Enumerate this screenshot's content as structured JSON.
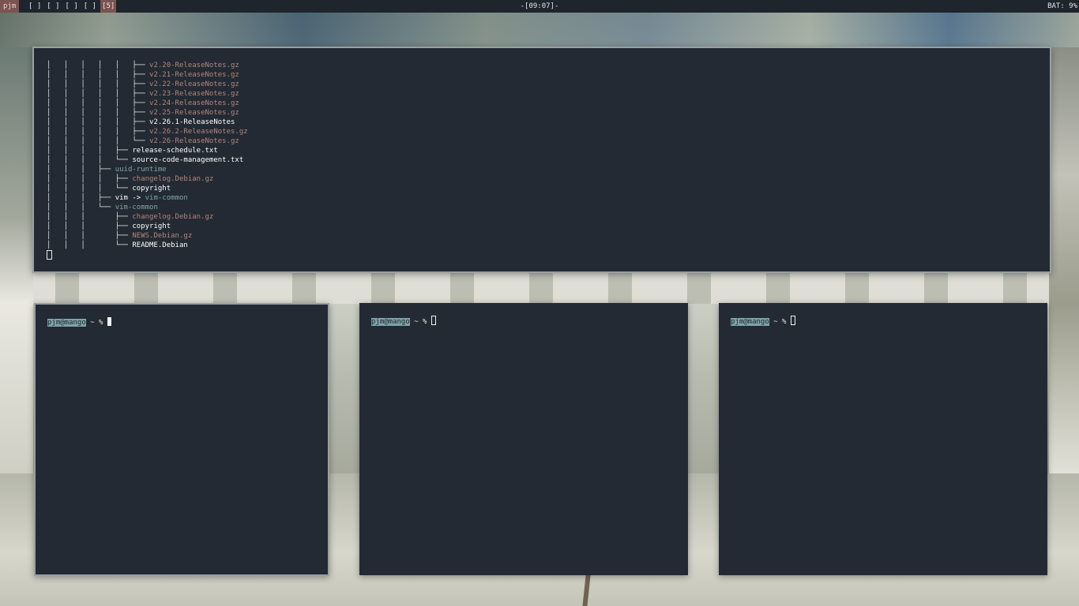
{
  "status_bar": {
    "user": "pjm",
    "workspaces": [
      {
        "label": "[ ]",
        "active": false
      },
      {
        "label": "[ ]",
        "active": false
      },
      {
        "label": "[ ]",
        "active": false
      },
      {
        "label": "[ ]",
        "active": false
      },
      {
        "label": "[5]",
        "active": true
      }
    ],
    "clock": "-[09:07]-",
    "battery": "BAT: 9%"
  },
  "tree_terminal": {
    "lines": [
      {
        "prefix": "│   │   │   │   │   ├── ",
        "name": "v2.20-ReleaseNotes.gz",
        "type": "gz"
      },
      {
        "prefix": "│   │   │   │   │   ├── ",
        "name": "v2.21-ReleaseNotes.gz",
        "type": "gz"
      },
      {
        "prefix": "│   │   │   │   │   ├── ",
        "name": "v2.22-ReleaseNotes.gz",
        "type": "gz"
      },
      {
        "prefix": "│   │   │   │   │   ├── ",
        "name": "v2.23-ReleaseNotes.gz",
        "type": "gz"
      },
      {
        "prefix": "│   │   │   │   │   ├── ",
        "name": "v2.24-ReleaseNotes.gz",
        "type": "gz"
      },
      {
        "prefix": "│   │   │   │   │   ├── ",
        "name": "v2.25-ReleaseNotes.gz",
        "type": "gz"
      },
      {
        "prefix": "│   │   │   │   │   ├── ",
        "name": "v2.26.1-ReleaseNotes",
        "type": "txt"
      },
      {
        "prefix": "│   │   │   │   │   ├── ",
        "name": "v2.26.2-ReleaseNotes.gz",
        "type": "gz"
      },
      {
        "prefix": "│   │   │   │   │   └── ",
        "name": "v2.26-ReleaseNotes.gz",
        "type": "gz"
      },
      {
        "prefix": "│   │   │   │   ├── ",
        "name": "release-schedule.txt",
        "type": "txt"
      },
      {
        "prefix": "│   │   │   │   └── ",
        "name": "source-code-management.txt",
        "type": "txt"
      },
      {
        "prefix": "│   │   │   ├── ",
        "name": "uuid-runtime",
        "type": "dir"
      },
      {
        "prefix": "│   │   │   │   ├── ",
        "name": "changelog.Debian.gz",
        "type": "gz"
      },
      {
        "prefix": "│   │   │   │   └── ",
        "name": "copyright",
        "type": "txt"
      },
      {
        "prefix": "│   │   │   ├── ",
        "name": "vim -> ",
        "type": "txt",
        "target": "vim-common"
      },
      {
        "prefix": "│   │   │   └── ",
        "name": "vim-common",
        "type": "dir"
      },
      {
        "prefix": "│   │   │       ├── ",
        "name": "changelog.Debian.gz",
        "type": "gz"
      },
      {
        "prefix": "│   │   │       ├── ",
        "name": "copyright",
        "type": "txt"
      },
      {
        "prefix": "│   │   │       ├── ",
        "name": "NEWS.Debian.gz",
        "type": "gz"
      },
      {
        "prefix": "│   │   │       └── ",
        "name": "README.Debian",
        "type": "txt"
      }
    ]
  },
  "prompts": {
    "host": "pjm@mango",
    "rest": " ~ % "
  },
  "colors": {
    "terminal_bg": "#232a33",
    "bar_bg": "#1f252c",
    "accent": "#7b5350",
    "gz_file": "#b2867c",
    "directory": "#7fa6a6",
    "prompt_host_bg": "#7da3a8"
  }
}
